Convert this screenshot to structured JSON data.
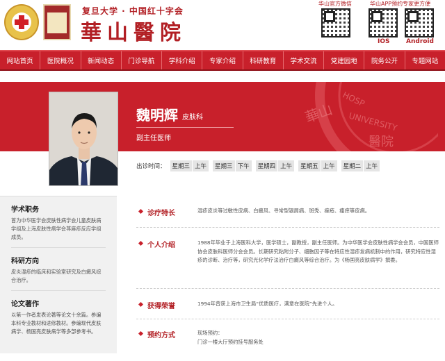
{
  "header": {
    "university_line": "复旦大学 · 中国红十字会",
    "hospital_name": "華山醫院",
    "qr_wechat_label": "华山官方微信",
    "qr_app_label": "华山APP预约专家更方便",
    "qr_ios": "IOS",
    "qr_android": "Android"
  },
  "nav": {
    "items": [
      "网站首页",
      "医院概况",
      "新闻动态",
      "门诊导航",
      "学科介绍",
      "专家介绍",
      "科研教育",
      "学术交流",
      "党建园地",
      "院务公开",
      "专题网站"
    ]
  },
  "doctor": {
    "name": "魏明辉",
    "department": "皮肤科",
    "title": "副主任医师"
  },
  "schedule": {
    "label": "出诊时间：",
    "slots": [
      {
        "day": "星期三",
        "time": "上午"
      },
      {
        "day": "星期三",
        "time": "下午"
      },
      {
        "day": "星期四",
        "time": "上午"
      },
      {
        "day": "星期五",
        "time": "上午"
      },
      {
        "day": "星期二",
        "time": "上午"
      }
    ]
  },
  "left_panel": {
    "sections": [
      {
        "title": "学术职务",
        "text": "首为中华医学会皮肤性病学会儿童皮肤病学组及上海皮肤性病学会荨麻疹反应学组成员。"
      },
      {
        "title": "科研方向",
        "text": "皮炎湿疹的临床和实验室研究及白癜风综合治疗。"
      },
      {
        "title": "论文著作",
        "text": "以第一作者发表论著等论文十余篇。参编本科专业教材和进修教材。参编现代皮肤病学、杨国亮皮肤病学等多部参考书。"
      }
    ]
  },
  "right_panel": {
    "rows": [
      {
        "label": "诊疗特长",
        "text": "湿疹皮炎等过敏性皮病、白癜风、寻常型银屑病、斑秃、痤疮、瘙痒等皮病。"
      },
      {
        "label": "个人介绍",
        "text": "1988年毕业于上海医科大学，医学硕士，副教授，副主任医师。为中华医学会皮肤性病学会会员，中国医师协会皮肤科医师分会会员。长期研究粘附分子、细胞因子等在特应性湿疹发病机制中的作用，研究特应性湿疹的诊断、治疗等，研究光化学疗法治疗白癜风等综合治疗。为《杨国亮皮肤病学》撰委。"
      },
      {
        "label": "获得荣誉",
        "text": "1994年曾获上海市卫生局“优质医疗，满意在医院”先进个人。"
      },
      {
        "label": "预约方式",
        "text": "现场预约：\n门诊一楼大厅预约挂号服务处"
      }
    ]
  },
  "colors": {
    "brand_red": "#c8202b",
    "text_red": "#b21f24"
  }
}
